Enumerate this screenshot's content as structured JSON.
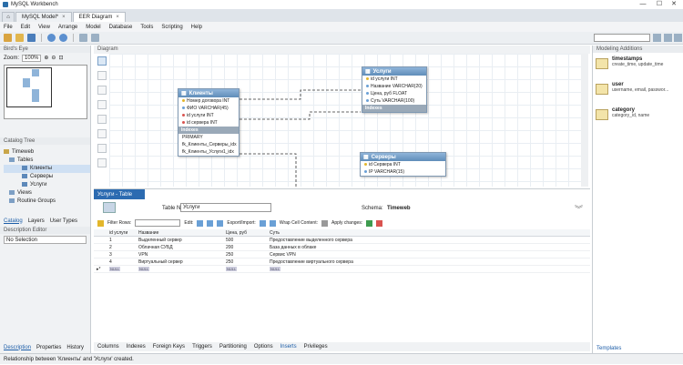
{
  "window": {
    "title": "MySQL Workbench",
    "minimize": "—",
    "maximize": "☐",
    "close": "✕"
  },
  "tabs": [
    {
      "label": "MySQL Model*"
    },
    {
      "label": "EER Diagram"
    }
  ],
  "menu": [
    "File",
    "Edit",
    "View",
    "Arrange",
    "Model",
    "Database",
    "Tools",
    "Scripting",
    "Help"
  ],
  "left": {
    "birds_eye": "Bird's Eye",
    "zoom_label": "Zoom:",
    "zoom_value": "100%",
    "catalog_tree": "Catalog Tree",
    "tree": {
      "schema": "Timeweb",
      "tables": "Tables",
      "items": [
        "Клиенты",
        "Серверы",
        "Услуги"
      ],
      "views": "Views",
      "routines": "Routine Groups"
    },
    "catalog_tabs": [
      "Catalog",
      "Layers",
      "User Types"
    ],
    "description_title": "Description Editor",
    "description_value": "No Selection",
    "bottom_tabs": [
      "Description",
      "Properties",
      "History"
    ]
  },
  "diagram": {
    "title": "Diagram",
    "entities": [
      {
        "name": "Клиенты",
        "columns": [
          "Номер договора INT",
          "ФИО VARCHAR(45)",
          "id услуги INT",
          "id сервера INT"
        ],
        "indexes_label": "Indexes",
        "indexes": [
          "PRIMARY",
          "fk_Клиенты_Серверы_idx",
          "fk_Клиенты_Услуги1_idx"
        ]
      },
      {
        "name": "Услуги",
        "columns": [
          "id услуги INT",
          "Название VARCHAR(20)",
          "Цена, руб FLOAT",
          "Суть VARCHAR(100)"
        ],
        "indexes_label": "Indexes"
      },
      {
        "name": "Серверы",
        "columns": [
          "id Сервера INT",
          "IP VARCHAR(15)"
        ]
      }
    ]
  },
  "modeling": {
    "title": "Modeling Additions",
    "snippets": [
      {
        "name": "timestamps",
        "desc": "create_time, update_time"
      },
      {
        "name": "user",
        "desc": "username, email, passwor..."
      },
      {
        "name": "category",
        "desc": "category_id, name"
      }
    ],
    "bottom_tab": "Templates"
  },
  "editor": {
    "tab": "Услуги - Table",
    "table_name_label": "Table Name:",
    "table_name": "Услуги",
    "schema_label": "Schema:",
    "schema": "Timeweb",
    "filter_label": "Filter Rows:",
    "edit_label": "Edit:",
    "export_label": "Export/Import:",
    "wrap_label": "Wrap Cell Content:",
    "apply_label": "Apply changes:",
    "headers": [
      "id услуги",
      "Название",
      "Цена, руб",
      "Суть"
    ],
    "rows": [
      [
        "1",
        "Выделенный сервер",
        "500",
        "Предоставление выделенного сервера"
      ],
      [
        "2",
        "Облачная СУБД",
        "200",
        "База данных в облаке"
      ],
      [
        "3",
        "VPN",
        "250",
        "Сервис VPN"
      ],
      [
        "4",
        "Виртуальный сервер",
        "250",
        "Предоставление виртуального сервера"
      ]
    ],
    "null_text": "NULL",
    "bottom_tabs": [
      "Columns",
      "Indexes",
      "Foreign Keys",
      "Triggers",
      "Partitioning",
      "Options",
      "Inserts",
      "Privileges"
    ]
  },
  "status": "Relationship between 'Клиенты' and 'Услуги' created."
}
